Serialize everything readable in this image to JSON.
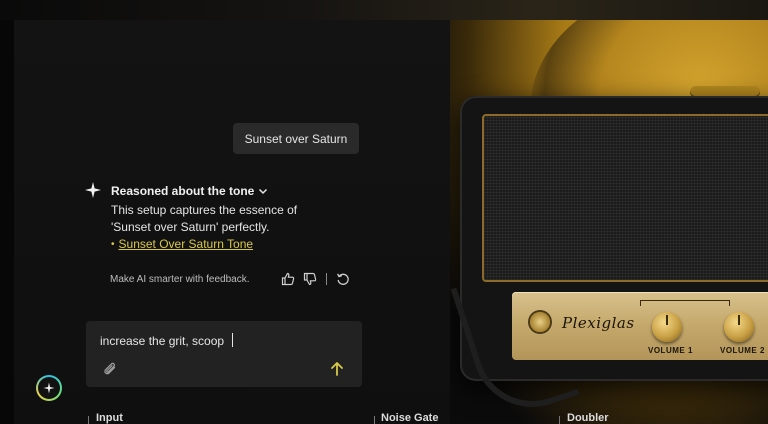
{
  "chat": {
    "user_message": "Sunset over Saturn",
    "assistant": {
      "reasoning_title": "Reasoned about the tone",
      "response_text": "This setup captures the essence of 'Sunset over Saturn' perfectly.",
      "link_text": "Sunset Over Saturn Tone"
    },
    "feedback": {
      "prompt_text": "Make AI smarter with feedback."
    },
    "composer": {
      "value": "increase the grit, scoop",
      "placeholder": ""
    }
  },
  "amp": {
    "brand_text": "Plexiglas",
    "knobs": [
      {
        "label": "VOLUME 1"
      },
      {
        "label": "VOLUME 2"
      }
    ]
  },
  "signal_chain": {
    "items": [
      {
        "label": "Input"
      },
      {
        "label": "Noise Gate"
      },
      {
        "label": "Doubler"
      }
    ]
  },
  "colors": {
    "accent_yellow": "#d8c84a",
    "amp_gold": "#c4a86b",
    "panel_bg": "#131313"
  },
  "icons": [
    "sparkle-icon",
    "chevron-down-icon",
    "thumbs-up-icon",
    "thumbs-down-icon",
    "refresh-icon",
    "paperclip-icon",
    "arrow-up-icon",
    "ai-assistant-icon"
  ]
}
